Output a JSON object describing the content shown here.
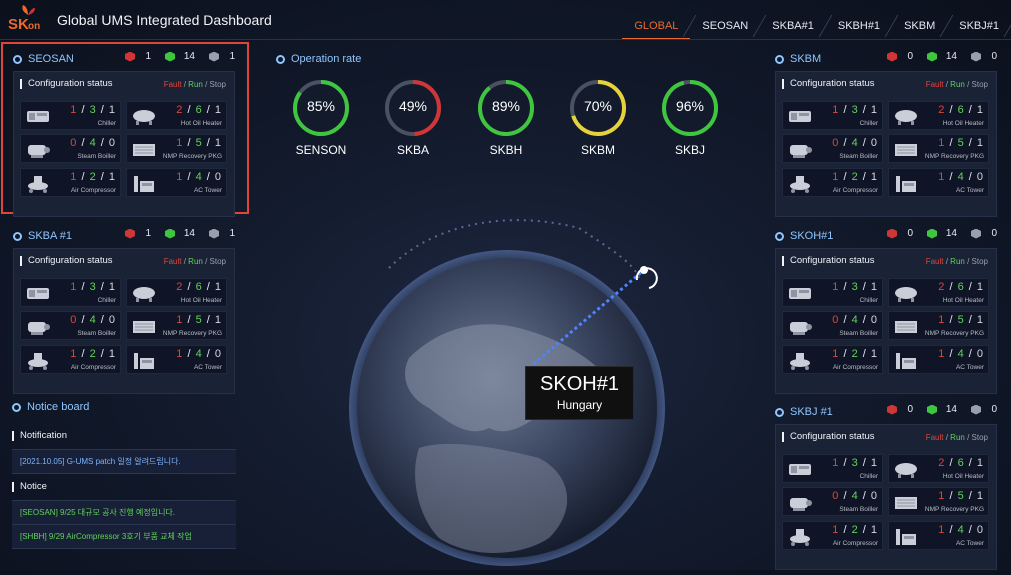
{
  "header": {
    "logo_sk": "SK",
    "logo_on": "on",
    "title": "Global UMS Integrated Dashboard",
    "tabs": [
      "GLOBAL",
      "SEOSAN",
      "SKBA#1",
      "SKBH#1",
      "SKBM",
      "SKBJ#1"
    ],
    "active_tab": "GLOBAL"
  },
  "colors": {
    "accent": "#ea6a2c",
    "fault": "#e0453a",
    "run": "#62d25a",
    "title_blue": "#8fc6ff"
  },
  "common": {
    "config_title": "Configuration status",
    "legend_fault": "Fault",
    "legend_run": "Run",
    "legend_stop": "Stop"
  },
  "panels": [
    {
      "name": "SEOSAN",
      "counts": [
        "1",
        "14",
        "1"
      ],
      "items": [
        {
          "label": "Chiller",
          "a": "1",
          "b": "3",
          "c": "1",
          "icon": "chiller-icon"
        },
        {
          "label": "Hot Oil Heater",
          "a": "2",
          "b": "6",
          "c": "1",
          "icon": "hot-oil-heater-icon"
        },
        {
          "label": "Steam Boiller",
          "a": "0",
          "b": "4",
          "c": "0",
          "icon": "steam-boiler-icon"
        },
        {
          "label": "NMP Recovery PKG",
          "a": "1",
          "b": "5",
          "c": "1",
          "icon": "nmp-recovery-icon"
        },
        {
          "label": "Air Compressor",
          "a": "1",
          "b": "2",
          "c": "1",
          "icon": "air-compressor-icon"
        },
        {
          "label": "AC Tower",
          "a": "1",
          "b": "4",
          "c": "0",
          "icon": "ac-tower-icon"
        }
      ]
    },
    {
      "name": "SKBA #1",
      "counts": [
        "1",
        "14",
        "1"
      ],
      "items": [
        {
          "label": "Chiller",
          "a": "1",
          "b": "3",
          "c": "1",
          "icon": "chiller-icon"
        },
        {
          "label": "Hot Oil Heater",
          "a": "2",
          "b": "6",
          "c": "1",
          "icon": "hot-oil-heater-icon"
        },
        {
          "label": "Steam Boiller",
          "a": "0",
          "b": "4",
          "c": "0",
          "icon": "steam-boiler-icon"
        },
        {
          "label": "NMP Recovery PKG",
          "a": "1",
          "b": "5",
          "c": "1",
          "icon": "nmp-recovery-icon"
        },
        {
          "label": "Air Compressor",
          "a": "1",
          "b": "2",
          "c": "1",
          "icon": "air-compressor-icon"
        },
        {
          "label": "AC Tower",
          "a": "1",
          "b": "4",
          "c": "0",
          "icon": "ac-tower-icon"
        }
      ]
    },
    {
      "name": "SKBM",
      "counts": [
        "0",
        "14",
        "0"
      ],
      "items": [
        {
          "label": "Chiller",
          "a": "1",
          "b": "3",
          "c": "1",
          "icon": "chiller-icon"
        },
        {
          "label": "Hot Oil Heater",
          "a": "2",
          "b": "6",
          "c": "1",
          "icon": "hot-oil-heater-icon"
        },
        {
          "label": "Steam Boiller",
          "a": "0",
          "b": "4",
          "c": "0",
          "icon": "steam-boiler-icon"
        },
        {
          "label": "NMP Recovery PKG",
          "a": "1",
          "b": "5",
          "c": "1",
          "icon": "nmp-recovery-icon"
        },
        {
          "label": "Air Compressor",
          "a": "1",
          "b": "2",
          "c": "1",
          "icon": "air-compressor-icon"
        },
        {
          "label": "AC Tower",
          "a": "1",
          "b": "4",
          "c": "0",
          "icon": "ac-tower-icon"
        }
      ]
    },
    {
      "name": "SKOH#1",
      "counts": [
        "0",
        "14",
        "0"
      ],
      "items": [
        {
          "label": "Chiller",
          "a": "1",
          "b": "3",
          "c": "1",
          "icon": "chiller-icon"
        },
        {
          "label": "Hot Oil Heater",
          "a": "2",
          "b": "6",
          "c": "1",
          "icon": "hot-oil-heater-icon"
        },
        {
          "label": "Steam Boiller",
          "a": "0",
          "b": "4",
          "c": "0",
          "icon": "steam-boiler-icon"
        },
        {
          "label": "NMP Recovery PKG",
          "a": "1",
          "b": "5",
          "c": "1",
          "icon": "nmp-recovery-icon"
        },
        {
          "label": "Air Compressor",
          "a": "1",
          "b": "2",
          "c": "1",
          "icon": "air-compressor-icon"
        },
        {
          "label": "AC Tower",
          "a": "1",
          "b": "4",
          "c": "0",
          "icon": "ac-tower-icon"
        }
      ]
    },
    {
      "name": "SKBJ #1",
      "counts": [
        "0",
        "14",
        "0"
      ],
      "items": [
        {
          "label": "Chiller",
          "a": "1",
          "b": "3",
          "c": "1",
          "icon": "chiller-icon"
        },
        {
          "label": "Hot Oil Heater",
          "a": "2",
          "b": "6",
          "c": "1",
          "icon": "hot-oil-heater-icon"
        },
        {
          "label": "Steam Boiller",
          "a": "0",
          "b": "4",
          "c": "0",
          "icon": "steam-boiler-icon"
        },
        {
          "label": "NMP Recovery PKG",
          "a": "1",
          "b": "5",
          "c": "1",
          "icon": "nmp-recovery-icon"
        },
        {
          "label": "Air Compressor",
          "a": "1",
          "b": "2",
          "c": "1",
          "icon": "air-compressor-icon"
        },
        {
          "label": "AC Tower",
          "a": "1",
          "b": "4",
          "c": "0",
          "icon": "ac-tower-icon"
        }
      ]
    }
  ],
  "operation": {
    "title": "Operation rate",
    "gauges": [
      {
        "name": "SENSON",
        "value": 85,
        "text": "85%",
        "color": "#3ec63e"
      },
      {
        "name": "SKBA",
        "value": 49,
        "text": "49%",
        "color": "#d03636"
      },
      {
        "name": "SKBH",
        "value": 89,
        "text": "89%",
        "color": "#3ec63e"
      },
      {
        "name": "SKBM",
        "value": 70,
        "text": "70%",
        "color": "#e6d23a"
      },
      {
        "name": "SKBJ",
        "value": 96,
        "text": "96%",
        "color": "#3ec63e"
      }
    ]
  },
  "globe": {
    "site": "SKOH#1",
    "country": "Hungary"
  },
  "notice": {
    "title": "Notice board",
    "notification_label": "Notification",
    "notifications": [
      "[2021.10.05] G-UMS patch 일정 알려드립니다."
    ],
    "notice_label": "Notice",
    "notices": [
      "[SEOSAN] 9/25 대규모 공사 진행 예정입니다.",
      "[SHBH] 9/29 AirCompressor 3호기 부품 교체 작업"
    ]
  }
}
